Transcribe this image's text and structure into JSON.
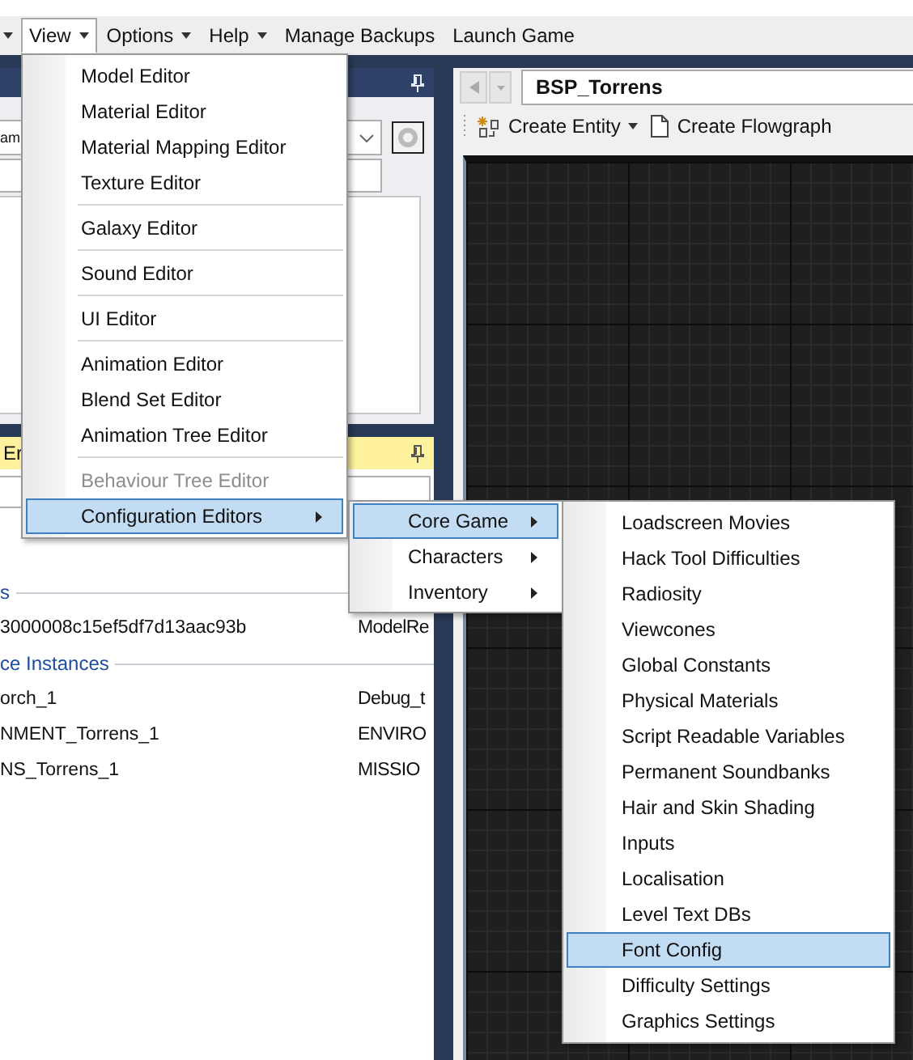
{
  "menubar": [
    {
      "label": "View",
      "dropdown": true,
      "selected": true
    },
    {
      "label": "Options",
      "dropdown": true,
      "selected": false
    },
    {
      "label": "Help",
      "dropdown": true,
      "selected": false
    },
    {
      "label": "Manage Backups",
      "dropdown": false,
      "selected": false
    },
    {
      "label": "Launch Game",
      "dropdown": false,
      "selected": false
    }
  ],
  "left_panel": {
    "combo_value": "am"
  },
  "properties_panel": {
    "header": "Er",
    "sections": [
      {
        "title": "s",
        "rows": [
          {
            "name": "3000008c15ef5df7d13aac93b",
            "value": "ModelRe"
          }
        ]
      },
      {
        "title": "ce Instances",
        "rows": [
          {
            "name": "orch_1",
            "value": "Debug_t"
          },
          {
            "name": "NMENT_Torrens_1",
            "value": "ENVIRO"
          },
          {
            "name": "NS_Torrens_1",
            "value": "MISSIO"
          }
        ]
      }
    ]
  },
  "document": {
    "path": "BSP_Torrens",
    "toolbar": [
      {
        "label": "Create Entity",
        "dropdown": true
      },
      {
        "label": "Create Flowgraph",
        "dropdown": false
      }
    ]
  },
  "view_menu": [
    {
      "kind": "item",
      "label": "Model Editor",
      "disabled": false,
      "selected": false,
      "submenu": false
    },
    {
      "kind": "item",
      "label": "Material Editor",
      "disabled": false,
      "selected": false,
      "submenu": false
    },
    {
      "kind": "item",
      "label": "Material Mapping Editor",
      "disabled": false,
      "selected": false,
      "submenu": false
    },
    {
      "kind": "item",
      "label": "Texture Editor",
      "disabled": false,
      "selected": false,
      "submenu": false
    },
    {
      "kind": "separator"
    },
    {
      "kind": "item",
      "label": "Galaxy Editor",
      "disabled": false,
      "selected": false,
      "submenu": false
    },
    {
      "kind": "separator"
    },
    {
      "kind": "item",
      "label": "Sound Editor",
      "disabled": false,
      "selected": false,
      "submenu": false
    },
    {
      "kind": "separator"
    },
    {
      "kind": "item",
      "label": "UI Editor",
      "disabled": false,
      "selected": false,
      "submenu": false
    },
    {
      "kind": "separator"
    },
    {
      "kind": "item",
      "label": "Animation Editor",
      "disabled": false,
      "selected": false,
      "submenu": false
    },
    {
      "kind": "item",
      "label": "Blend Set Editor",
      "disabled": false,
      "selected": false,
      "submenu": false
    },
    {
      "kind": "item",
      "label": "Animation Tree Editor",
      "disabled": false,
      "selected": false,
      "submenu": false
    },
    {
      "kind": "separator"
    },
    {
      "kind": "item",
      "label": "Behaviour Tree Editor",
      "disabled": true,
      "selected": false,
      "submenu": false
    },
    {
      "kind": "item",
      "label": "Configuration Editors",
      "disabled": false,
      "selected": true,
      "submenu": true
    }
  ],
  "config_submenu": [
    {
      "kind": "item",
      "label": "Core Game",
      "disabled": false,
      "selected": true,
      "submenu": true
    },
    {
      "kind": "item",
      "label": "Characters",
      "disabled": false,
      "selected": false,
      "submenu": true
    },
    {
      "kind": "item",
      "label": "Inventory",
      "disabled": false,
      "selected": false,
      "submenu": true
    }
  ],
  "core_game_submenu": [
    {
      "kind": "item",
      "label": "Loadscreen Movies",
      "disabled": false,
      "selected": false,
      "submenu": false
    },
    {
      "kind": "item",
      "label": "Hack Tool Difficulties",
      "disabled": false,
      "selected": false,
      "submenu": false
    },
    {
      "kind": "item",
      "label": "Radiosity",
      "disabled": false,
      "selected": false,
      "submenu": false
    },
    {
      "kind": "item",
      "label": "Viewcones",
      "disabled": false,
      "selected": false,
      "submenu": false
    },
    {
      "kind": "item",
      "label": "Global Constants",
      "disabled": false,
      "selected": false,
      "submenu": false
    },
    {
      "kind": "item",
      "label": "Physical Materials",
      "disabled": false,
      "selected": false,
      "submenu": false
    },
    {
      "kind": "item",
      "label": "Script Readable Variables",
      "disabled": false,
      "selected": false,
      "submenu": false
    },
    {
      "kind": "item",
      "label": "Permanent Soundbanks",
      "disabled": false,
      "selected": false,
      "submenu": false
    },
    {
      "kind": "item",
      "label": "Hair and Skin Shading",
      "disabled": false,
      "selected": false,
      "submenu": false
    },
    {
      "kind": "item",
      "label": "Inputs",
      "disabled": false,
      "selected": false,
      "submenu": false
    },
    {
      "kind": "item",
      "label": "Localisation",
      "disabled": false,
      "selected": false,
      "submenu": false
    },
    {
      "kind": "item",
      "label": "Level Text DBs",
      "disabled": false,
      "selected": false,
      "submenu": false
    },
    {
      "kind": "item",
      "label": "Font Config",
      "disabled": false,
      "selected": true,
      "submenu": false
    },
    {
      "kind": "item",
      "label": "Difficulty Settings",
      "disabled": false,
      "selected": false,
      "submenu": false
    },
    {
      "kind": "item",
      "label": "Graphics Settings",
      "disabled": false,
      "selected": false,
      "submenu": false
    }
  ]
}
